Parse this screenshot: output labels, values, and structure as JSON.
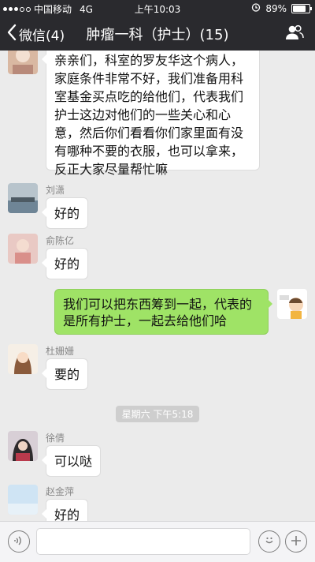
{
  "status": {
    "carrier": "中国移动",
    "network": "4G",
    "time": "上午10:03",
    "battery": "89%",
    "battery_level": 0.89
  },
  "nav": {
    "back_label": "微信(4)",
    "title": "肿瘤一科（护士）(15)"
  },
  "messages": [
    {
      "side": "left",
      "sender": "",
      "text": "亲亲们，科室的罗友华这个病人，家庭条件非常不好，我们准备用科室基金买点吃的给他们，代表我们护士这边对他们的一些关心和心意，然后你们看看你们家里面有没有哪种不要的衣服，也可以拿来，反正大家尽量帮忙嘛"
    },
    {
      "side": "left",
      "sender": "刘潇",
      "text": "好的"
    },
    {
      "side": "left",
      "sender": "俞陈亿",
      "text": "好的"
    },
    {
      "side": "right",
      "sender": "",
      "text": "我们可以把东西筹到一起，代表的是所有护士，一起去给他们哈"
    },
    {
      "side": "left",
      "sender": "杜姗姗",
      "text": "要的"
    },
    {
      "side": "left",
      "sender": "徐倩",
      "text": "可以哒"
    },
    {
      "side": "left",
      "sender": "赵金萍",
      "text": "好的"
    }
  ],
  "timestamp": "星期六 下午5:18",
  "icons": {
    "back": "chevron-left-icon",
    "contacts": "people-icon",
    "voice": "voice-icon",
    "emoji": "emoji-icon",
    "plus": "plus-icon"
  },
  "colors": {
    "nav_bg": "#2a2a2e",
    "chat_bg": "#ebebeb",
    "self_bubble": "#9fe366"
  }
}
